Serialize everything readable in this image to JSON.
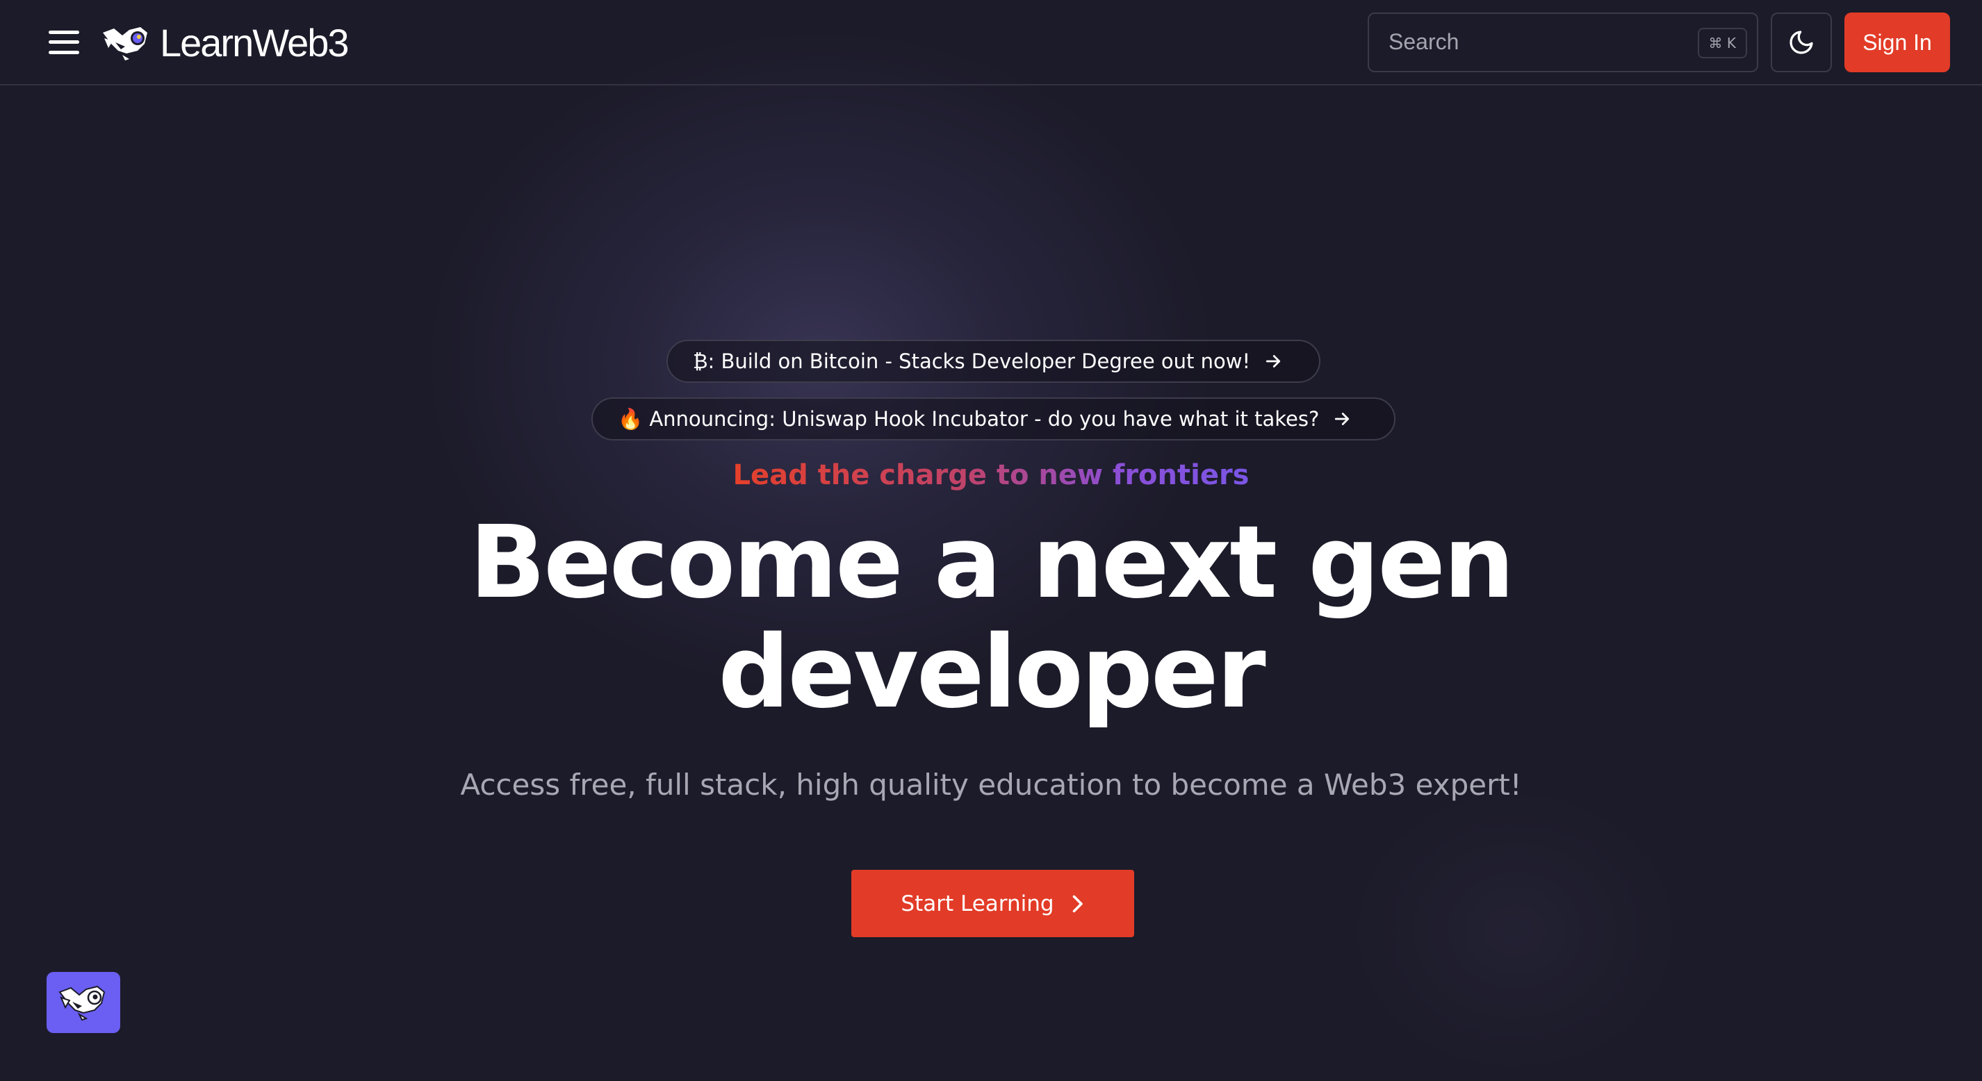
{
  "header": {
    "menu_icon": "hamburger-menu-icon",
    "logo_icon": "learnweb3-bird-icon",
    "logo_text": "LearnWeb3",
    "search": {
      "placeholder": "Search",
      "shortcut": "⌘ K"
    },
    "theme_toggle_icon": "moon-icon",
    "sign_in_label": "Sign In"
  },
  "announcements": [
    {
      "text": "₿: Build on Bitcoin - Stacks Developer Degree out now!",
      "icon": "arrow-right-icon"
    },
    {
      "text": "🔥 Announcing: Uniswap Hook Incubator - do you have what it takes?",
      "icon": "arrow-right-icon"
    }
  ],
  "hero": {
    "tagline": "Lead the charge to new frontiers",
    "title_line_1": "Become a next gen",
    "title_line_2": "developer",
    "subtitle": "Access free, full stack, high quality education to become a Web3 expert!",
    "cta_label": "Start Learning",
    "cta_icon": "chevron-right-icon"
  },
  "chat_widget": {
    "icon": "learnweb3-bird-icon"
  },
  "colors": {
    "background": "#1c1b29",
    "accent": "#e23b27",
    "widget": "#6a5ff2",
    "gradient_start": "#e5402a",
    "gradient_end": "#7a56e6"
  }
}
